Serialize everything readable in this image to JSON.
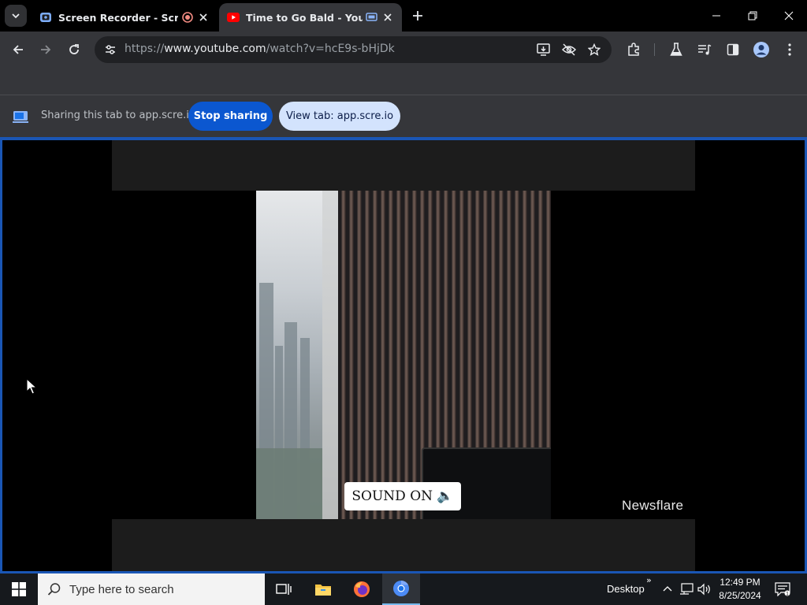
{
  "browser": {
    "tabs": [
      {
        "title": "Screen Recorder - Scre.io",
        "active": false
      },
      {
        "title": "Time to Go Bald - YouTube",
        "active": true
      }
    ],
    "url": {
      "scheme": "https://",
      "host": "www.youtube.com",
      "path": "/watch?v=hcE9s-bHjDk"
    }
  },
  "sharebar": {
    "message": "Sharing this tab to app.scre.io",
    "stop_label": "Stop sharing",
    "view_label": "View tab: app.scre.io"
  },
  "video": {
    "badge": "SOUND ON 🔈",
    "watermark": "Newsflare"
  },
  "taskbar": {
    "search_placeholder": "Type here to search",
    "desktop_label": "Desktop",
    "chevron": "»",
    "time": "12:49 PM",
    "date": "8/25/2024"
  },
  "colors": {
    "accent_blue": "#0b57d0",
    "view_button_bg": "#d3e3fd",
    "share_border": "#1a56b5",
    "youtube_red": "#ff0000"
  }
}
